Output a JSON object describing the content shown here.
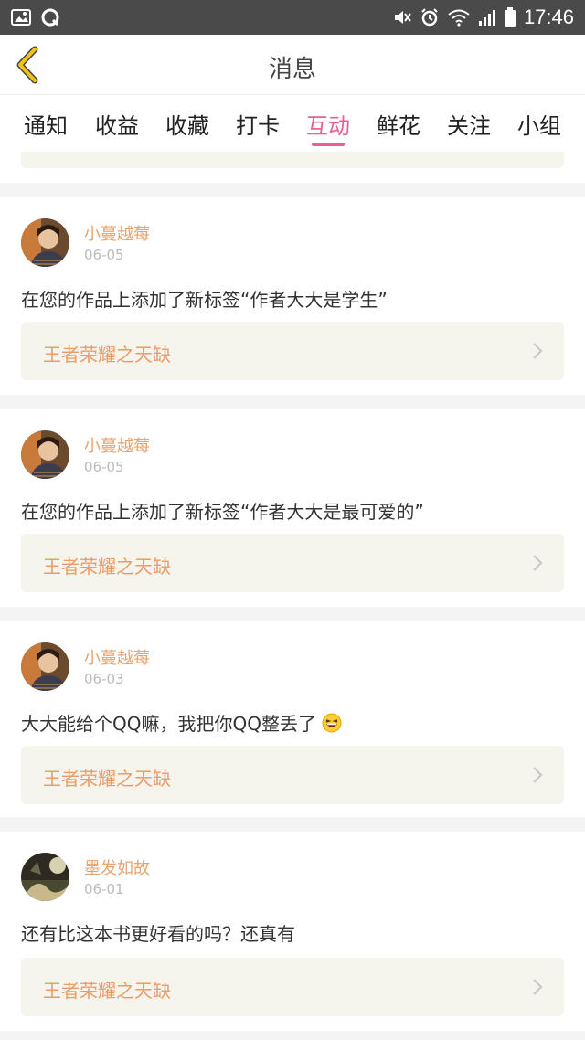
{
  "status_bar": {
    "time": "17:46",
    "left_icons": [
      "image-icon",
      "qq-icon"
    ],
    "right_icons": [
      "mute-icon",
      "alarm-icon",
      "wifi-icon",
      "signal-icon",
      "battery-icon"
    ]
  },
  "navbar": {
    "title": "消息",
    "back_icon": "chevron-left-icon"
  },
  "tabs": {
    "items": [
      {
        "label": "通知"
      },
      {
        "label": "收益"
      },
      {
        "label": "收藏"
      },
      {
        "label": "打卡"
      },
      {
        "label": "互动"
      },
      {
        "label": "鲜花"
      },
      {
        "label": "关注"
      },
      {
        "label": "小组"
      }
    ],
    "active": "互动"
  },
  "messages": [
    {
      "user": "小蔓越莓",
      "date": "06-05",
      "text": "在您的作品上添加了新标签“作者大大是学生”",
      "link": "王者荣耀之天缺",
      "avatar": "avatar-girl"
    },
    {
      "user": "小蔓越莓",
      "date": "06-05",
      "text": "在您的作品上添加了新标签“作者大大是最可爱的”",
      "link": "王者荣耀之天缺",
      "avatar": "avatar-girl"
    },
    {
      "user": "小蔓越莓",
      "date": "06-03",
      "text": "大大能给个QQ嘛，我把你QQ整丢了",
      "emoji": "laughing-emoji",
      "link": "王者荣耀之天缺",
      "avatar": "avatar-girl"
    },
    {
      "user": "墨发如故",
      "date": "06-01",
      "text": "还有比这本书更好看的吗？还真有",
      "link": "王者荣耀之天缺",
      "avatar": "avatar-scenery"
    }
  ],
  "colors": {
    "accent_pink": "#e95f96",
    "username_orange": "#e9a36f",
    "link_orange": "#ec9a66",
    "back_arrow_yellow": "#f1c21b",
    "link_bg": "#f5f5ee"
  }
}
